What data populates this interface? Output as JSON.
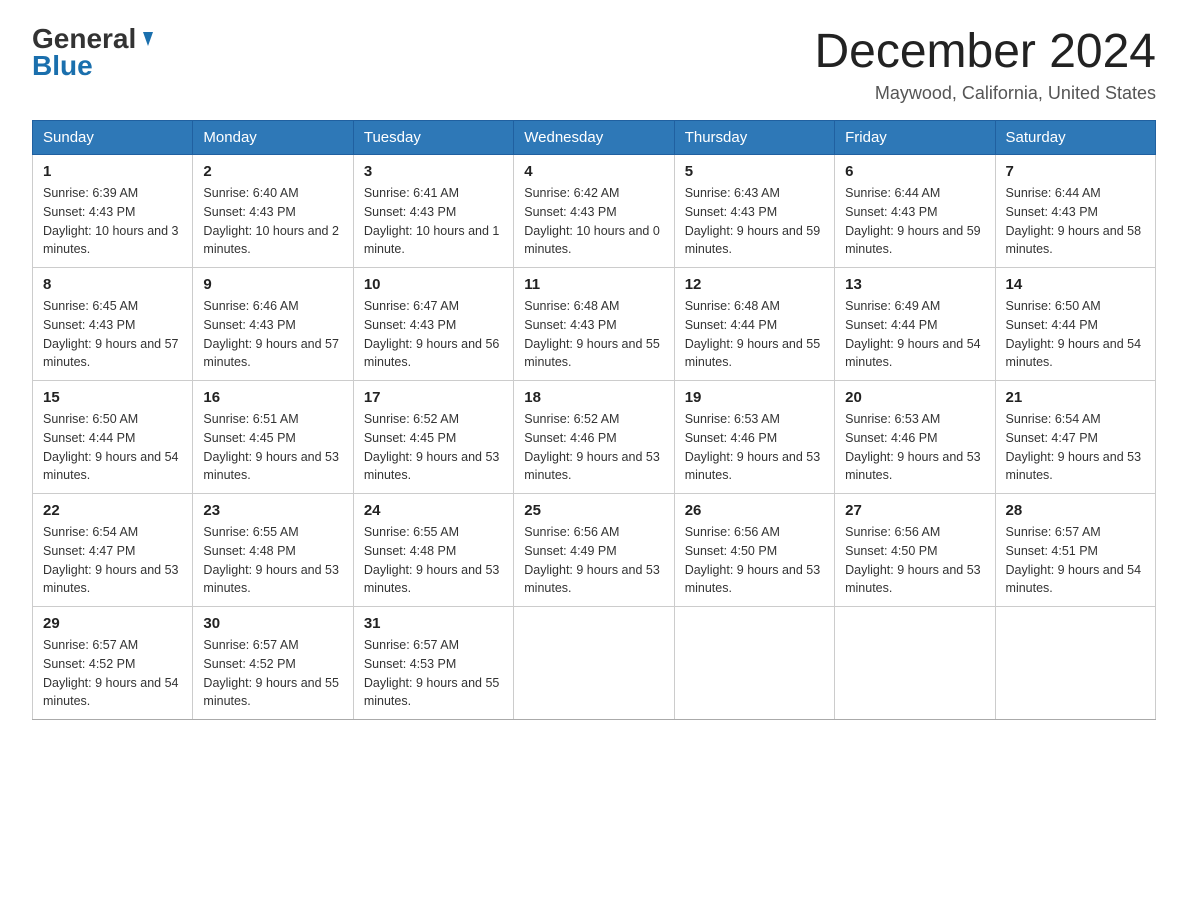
{
  "header": {
    "logo_general": "General",
    "logo_blue": "Blue",
    "title": "December 2024",
    "location": "Maywood, California, United States"
  },
  "days_of_week": [
    "Sunday",
    "Monday",
    "Tuesday",
    "Wednesday",
    "Thursday",
    "Friday",
    "Saturday"
  ],
  "weeks": [
    [
      {
        "day": "1",
        "sunrise": "6:39 AM",
        "sunset": "4:43 PM",
        "daylight": "10 hours and 3 minutes."
      },
      {
        "day": "2",
        "sunrise": "6:40 AM",
        "sunset": "4:43 PM",
        "daylight": "10 hours and 2 minutes."
      },
      {
        "day": "3",
        "sunrise": "6:41 AM",
        "sunset": "4:43 PM",
        "daylight": "10 hours and 1 minute."
      },
      {
        "day": "4",
        "sunrise": "6:42 AM",
        "sunset": "4:43 PM",
        "daylight": "10 hours and 0 minutes."
      },
      {
        "day": "5",
        "sunrise": "6:43 AM",
        "sunset": "4:43 PM",
        "daylight": "9 hours and 59 minutes."
      },
      {
        "day": "6",
        "sunrise": "6:44 AM",
        "sunset": "4:43 PM",
        "daylight": "9 hours and 59 minutes."
      },
      {
        "day": "7",
        "sunrise": "6:44 AM",
        "sunset": "4:43 PM",
        "daylight": "9 hours and 58 minutes."
      }
    ],
    [
      {
        "day": "8",
        "sunrise": "6:45 AM",
        "sunset": "4:43 PM",
        "daylight": "9 hours and 57 minutes."
      },
      {
        "day": "9",
        "sunrise": "6:46 AM",
        "sunset": "4:43 PM",
        "daylight": "9 hours and 57 minutes."
      },
      {
        "day": "10",
        "sunrise": "6:47 AM",
        "sunset": "4:43 PM",
        "daylight": "9 hours and 56 minutes."
      },
      {
        "day": "11",
        "sunrise": "6:48 AM",
        "sunset": "4:43 PM",
        "daylight": "9 hours and 55 minutes."
      },
      {
        "day": "12",
        "sunrise": "6:48 AM",
        "sunset": "4:44 PM",
        "daylight": "9 hours and 55 minutes."
      },
      {
        "day": "13",
        "sunrise": "6:49 AM",
        "sunset": "4:44 PM",
        "daylight": "9 hours and 54 minutes."
      },
      {
        "day": "14",
        "sunrise": "6:50 AM",
        "sunset": "4:44 PM",
        "daylight": "9 hours and 54 minutes."
      }
    ],
    [
      {
        "day": "15",
        "sunrise": "6:50 AM",
        "sunset": "4:44 PM",
        "daylight": "9 hours and 54 minutes."
      },
      {
        "day": "16",
        "sunrise": "6:51 AM",
        "sunset": "4:45 PM",
        "daylight": "9 hours and 53 minutes."
      },
      {
        "day": "17",
        "sunrise": "6:52 AM",
        "sunset": "4:45 PM",
        "daylight": "9 hours and 53 minutes."
      },
      {
        "day": "18",
        "sunrise": "6:52 AM",
        "sunset": "4:46 PM",
        "daylight": "9 hours and 53 minutes."
      },
      {
        "day": "19",
        "sunrise": "6:53 AM",
        "sunset": "4:46 PM",
        "daylight": "9 hours and 53 minutes."
      },
      {
        "day": "20",
        "sunrise": "6:53 AM",
        "sunset": "4:46 PM",
        "daylight": "9 hours and 53 minutes."
      },
      {
        "day": "21",
        "sunrise": "6:54 AM",
        "sunset": "4:47 PM",
        "daylight": "9 hours and 53 minutes."
      }
    ],
    [
      {
        "day": "22",
        "sunrise": "6:54 AM",
        "sunset": "4:47 PM",
        "daylight": "9 hours and 53 minutes."
      },
      {
        "day": "23",
        "sunrise": "6:55 AM",
        "sunset": "4:48 PM",
        "daylight": "9 hours and 53 minutes."
      },
      {
        "day": "24",
        "sunrise": "6:55 AM",
        "sunset": "4:48 PM",
        "daylight": "9 hours and 53 minutes."
      },
      {
        "day": "25",
        "sunrise": "6:56 AM",
        "sunset": "4:49 PM",
        "daylight": "9 hours and 53 minutes."
      },
      {
        "day": "26",
        "sunrise": "6:56 AM",
        "sunset": "4:50 PM",
        "daylight": "9 hours and 53 minutes."
      },
      {
        "day": "27",
        "sunrise": "6:56 AM",
        "sunset": "4:50 PM",
        "daylight": "9 hours and 53 minutes."
      },
      {
        "day": "28",
        "sunrise": "6:57 AM",
        "sunset": "4:51 PM",
        "daylight": "9 hours and 54 minutes."
      }
    ],
    [
      {
        "day": "29",
        "sunrise": "6:57 AM",
        "sunset": "4:52 PM",
        "daylight": "9 hours and 54 minutes."
      },
      {
        "day": "30",
        "sunrise": "6:57 AM",
        "sunset": "4:52 PM",
        "daylight": "9 hours and 55 minutes."
      },
      {
        "day": "31",
        "sunrise": "6:57 AM",
        "sunset": "4:53 PM",
        "daylight": "9 hours and 55 minutes."
      },
      {
        "day": "",
        "sunrise": "",
        "sunset": "",
        "daylight": ""
      },
      {
        "day": "",
        "sunrise": "",
        "sunset": "",
        "daylight": ""
      },
      {
        "day": "",
        "sunrise": "",
        "sunset": "",
        "daylight": ""
      },
      {
        "day": "",
        "sunrise": "",
        "sunset": "",
        "daylight": ""
      }
    ]
  ]
}
